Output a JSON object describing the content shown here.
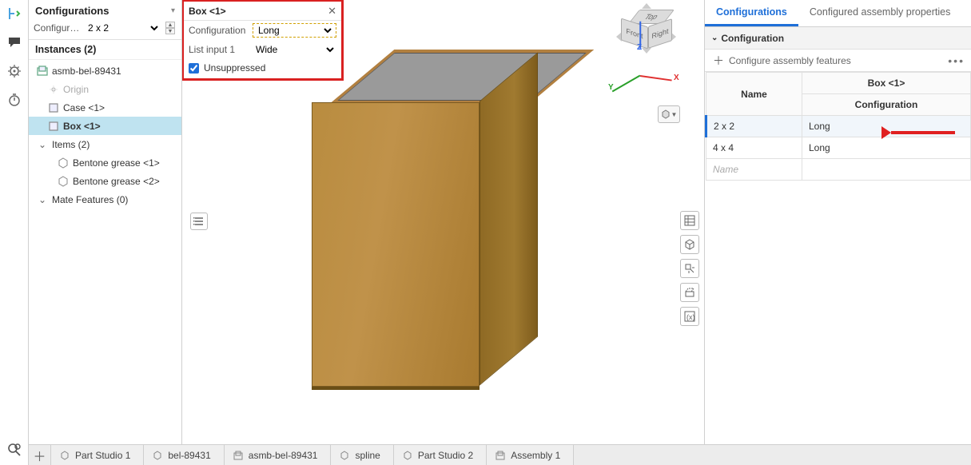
{
  "left_toolbar": {
    "icons": [
      "insert-feature",
      "comment",
      "history-gear",
      "stopwatch",
      "search-review"
    ]
  },
  "left_panel": {
    "title": "Configurations",
    "config_label": "Configurati…",
    "config_value": "2 x 2",
    "instances_header": "Instances (2)",
    "tree": {
      "asm": "asmb-bel-89431",
      "origin": "Origin",
      "case": "Case <1>",
      "box": "Box <1>",
      "items_label": "Items (2)",
      "item1": "Bentone grease <1>",
      "item2": "Bentone grease <2>",
      "mates_label": "Mate Features (0)"
    }
  },
  "popup": {
    "title": "Box <1>",
    "config_label": "Configuration",
    "config_value": "Long",
    "list_label": "List input 1",
    "list_value": "Wide",
    "unsup_label": "Unsuppressed"
  },
  "viewcube": {
    "top": "Top",
    "front": "Front",
    "right": "Right",
    "z": "Z",
    "x": "X",
    "y": "Y"
  },
  "right_panel": {
    "tab1": "Configurations",
    "tab2": "Configured assembly properties",
    "section": "Configuration",
    "addrow": "Configure assembly features",
    "col_group": "Box <1>",
    "col_name": "Name",
    "col_conf": "Configuration",
    "rows": [
      {
        "name": "2 x 2",
        "conf": "Long",
        "hl": true
      },
      {
        "name": "4 x 4",
        "conf": "Long",
        "hl": false
      }
    ],
    "name_placeholder": "Name"
  },
  "bottom_tabs": [
    {
      "label": "Part Studio 1",
      "icon": "part"
    },
    {
      "label": "bel-89431",
      "icon": "part"
    },
    {
      "label": "asmb-bel-89431",
      "icon": "asm"
    },
    {
      "label": "spline",
      "icon": "part"
    },
    {
      "label": "Part Studio 2",
      "icon": "part"
    },
    {
      "label": "Assembly 1",
      "icon": "asm"
    }
  ]
}
